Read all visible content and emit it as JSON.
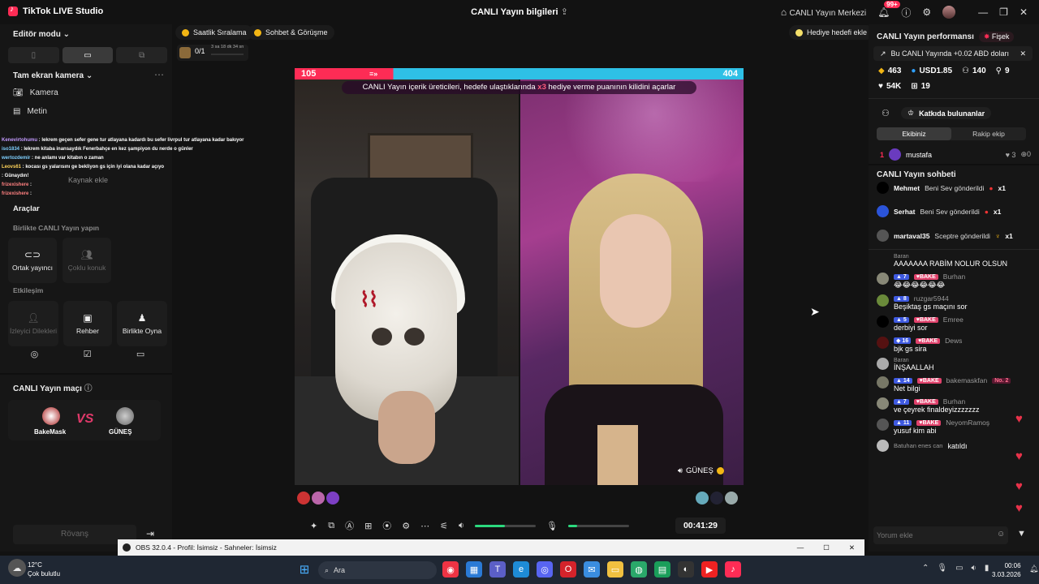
{
  "titlebar": {
    "app_name": "TikTok LIVE Studio",
    "center_title": "CANLI Yayın bilgileri",
    "live_center": "CANLI Yayın Merkezi",
    "notif_badge": "99+"
  },
  "left": {
    "editor_mode": "Editör modu",
    "scene": "Tam ekran kamera",
    "sources": [
      "Kamera",
      "Metin"
    ],
    "source_hint": "Kaynak ekle",
    "tools_title": "Araçlar",
    "collab_title": "Birlikte CANLI Yayın yapın",
    "collab_tools": [
      "Ortak yayıncı",
      "Çoklu konuk"
    ],
    "interaction_title": "Etkileşim",
    "interaction_tools": [
      "İzleyici Dilekleri",
      "Rehber",
      "Birlikte Oyna"
    ],
    "match_title": "CANLI Yayın maçı",
    "match_left": "BakeMask",
    "match_right": "GÜNEŞ",
    "match_vs": "VS",
    "rematch": "Rövanş"
  },
  "overlay_chat": [
    {
      "user": "Kenevirtohumu",
      "text": " : lekrem geçen sefer gene tur atlayana kadardı bu sefer livrpul tur atlayana kadar bakıyor"
    },
    {
      "user": "iso1834",
      "text": " : lekrem kitaba inansaydık Fenerbahçe en kez şampiyon du nerde o günler"
    },
    {
      "user": "wertozdemir",
      "text": " : ne anlamı var kitabın o zaman"
    },
    {
      "user": "Leovs61",
      "text": " : kocası gs yalarısını ge bekliyon gs için iyi olana kadar açıyo"
    },
    {
      "user": "",
      "text": " : Günaydın!"
    },
    {
      "user": "frizexishere",
      "text": " : "
    },
    {
      "user": "frizexishere",
      "text": " : "
    }
  ],
  "top_strip": {
    "hourly": "Saatlik Sıralama",
    "chat_meet": "Sohbet & Görüşme",
    "goal_progress": "0/1",
    "goal_time": "3 sa 18 dk 34 sn",
    "add_gift_goal": "Hediye hedefi ekle"
  },
  "battle": {
    "left_score": "105",
    "right_score": "404",
    "announcement_a": "CANLI Yayın içerik üreticileri, hedefe ulaştıklarında ",
    "multiplier": "x3",
    "announcement_b": " hediye verme puanının kilidini açarlar",
    "right_name": "GÜNEŞ"
  },
  "controls": {
    "timer": "00:41:29",
    "volume_level": 0.5,
    "mic_level": 0.15
  },
  "right": {
    "performance_title": "CANLI Yayın performansı",
    "fisek": "Fişek",
    "earning_note": "Bu CANLI Yayında +0.02 ABD doları",
    "stats": [
      "463",
      "USD1.85",
      "140",
      "9",
      "54K",
      "19"
    ],
    "contributors": "Katkıda bulunanlar",
    "tabs": [
      "Ekibiniz",
      "Rakip ekip"
    ],
    "top_rank": "1",
    "top_user": "mustafa",
    "top_likes": "3",
    "top_gifts": "0",
    "chat_title": "CANLI Yayın sohbeti",
    "gifts": [
      {
        "user": "Mehmet",
        "text": "Beni Sev gönderildi",
        "count": "x1"
      },
      {
        "user": "Serhat",
        "text": "Beni Sev gönderildi",
        "count": "x1"
      },
      {
        "user": "martaval35",
        "text": "Sceptre gönderildi",
        "count": "x1"
      }
    ],
    "chat": [
      {
        "user": "Baran",
        "level": "",
        "badge": "",
        "msg": "AAAAAAA RABİM NOLUR OLSUN"
      },
      {
        "user": "Burhan",
        "level": "7",
        "badge": "BAKE",
        "msg": "😂😂😂😂😂😂"
      },
      {
        "user": "ruzgar5944",
        "level": "8",
        "badge": "",
        "msg": "Beşiktaş gs maçını sor"
      },
      {
        "user": "Emree",
        "level": "5",
        "badge": "BAKE",
        "msg": "derbiyi sor"
      },
      {
        "user": "Dews",
        "level": "16",
        "badge": "BAKE",
        "msg": "bjk gs sira"
      },
      {
        "user": "Baran",
        "level": "",
        "badge": "",
        "msg": "İNŞAALLAH"
      },
      {
        "user": "bakemaskfan",
        "level": "14",
        "badge": "BAKE",
        "msg": "Net bilgi",
        "extra": "No. 2"
      },
      {
        "user": "Burhan",
        "level": "7",
        "badge": "BAKE",
        "msg": "ve çeyrek finaldeyizzzzzzz"
      },
      {
        "user": "NeyomRamoş",
        "level": "11",
        "badge": "BAKE",
        "msg": "yusuf kim abi"
      }
    ],
    "joined_user": "Batuhan enes can",
    "joined_text": "katıldı",
    "comment_placeholder": "Yorum ekle"
  },
  "obs": {
    "title": "OBS 32.0.4 - Profil: İsimsiz - Sahneler: İsimsiz"
  },
  "taskbar": {
    "weather_temp": "12°C",
    "weather_text": "Çok bulutlu",
    "search": "Ara",
    "time": "00:06",
    "date": "3.03.2026"
  }
}
